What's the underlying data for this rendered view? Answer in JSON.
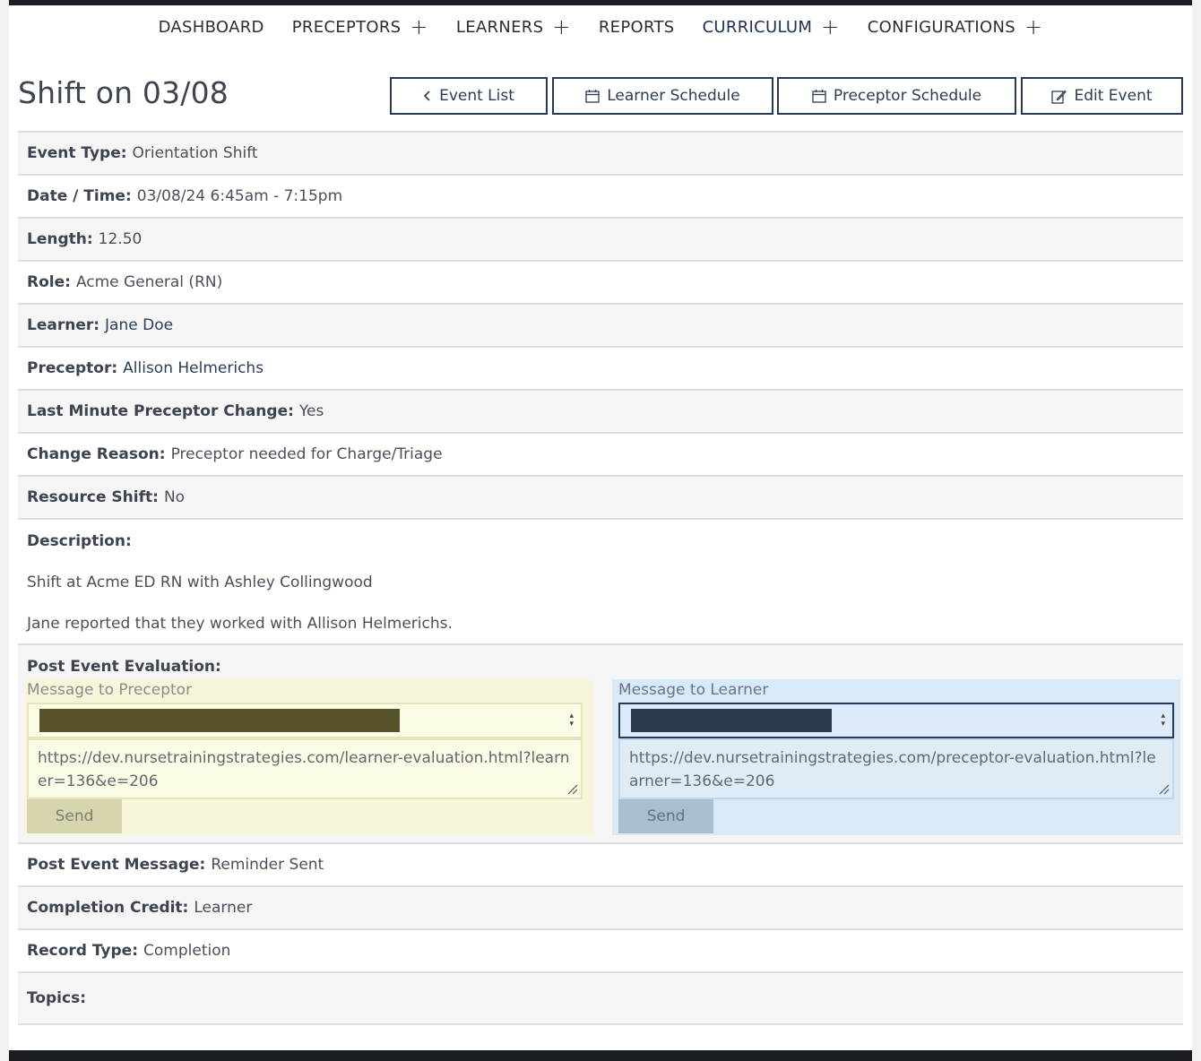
{
  "nav": {
    "items": [
      {
        "label": "DASHBOARD",
        "expandable": false
      },
      {
        "label": "PRECEPTORS",
        "expandable": true
      },
      {
        "label": "LEARNERS",
        "expandable": true
      },
      {
        "label": "REPORTS",
        "expandable": false
      },
      {
        "label": "CURRICULUM",
        "expandable": true
      },
      {
        "label": "CONFIGURATIONS",
        "expandable": true
      }
    ],
    "plus_glyph": "+"
  },
  "header": {
    "title": "Shift on 03/08",
    "buttons": {
      "event_list": "Event List",
      "learner_schedule": "Learner Schedule",
      "preceptor_schedule": "Preceptor Schedule",
      "edit_event": "Edit Event"
    }
  },
  "details": {
    "event_type": {
      "label": "Event Type:",
      "value": "Orientation Shift"
    },
    "date_time": {
      "label": "Date / Time:",
      "value": "03/08/24 6:45am - 7:15pm"
    },
    "length": {
      "label": "Length:",
      "value": "12.50"
    },
    "role": {
      "label": "Role:",
      "value": "Acme General (RN)"
    },
    "learner": {
      "label": "Learner:",
      "value": "Jane Doe"
    },
    "preceptor": {
      "label": "Preceptor:",
      "value": "Allison Helmerichs"
    },
    "last_minute_change": {
      "label": "Last Minute Preceptor Change:",
      "value": "Yes"
    },
    "change_reason": {
      "label": "Change Reason:",
      "value": "Preceptor needed for Charge/Triage"
    },
    "resource_shift": {
      "label": "Resource Shift:",
      "value": "No"
    }
  },
  "description": {
    "label": "Description:",
    "line1": "Shift at Acme ED RN with Ashley Collingwood",
    "line2": "Jane reported that they worked with Allison Helmerichs."
  },
  "evaluation": {
    "label": "Post Event Evaluation:",
    "preceptor_panel": {
      "title": "Message to Preceptor",
      "url": "https://dev.nursetrainingstrategies.com/learner-evaluation.html?learner=136&e=206",
      "send_label": "Send"
    },
    "learner_panel": {
      "title": "Message to Learner",
      "url": "https://dev.nursetrainingstrategies.com/preceptor-evaluation.html?learner=136&e=206",
      "send_label": "Send"
    }
  },
  "footer_details": {
    "post_event_message": {
      "label": "Post Event Message:",
      "value": "Reminder Sent"
    },
    "completion_credit": {
      "label": "Completion Credit:",
      "value": "Learner"
    },
    "record_type": {
      "label": "Record Type:",
      "value": "Completion"
    },
    "topics": {
      "label": "Topics:",
      "value": ""
    }
  },
  "colors": {
    "nav_active": "#1e3050",
    "button_border": "#243a5a",
    "preceptor_panel_bg": "#f7f6d8",
    "learner_panel_bg": "#d8eaf7",
    "redaction_preceptor": "#56532b",
    "redaction_learner": "#2a3b4d"
  }
}
